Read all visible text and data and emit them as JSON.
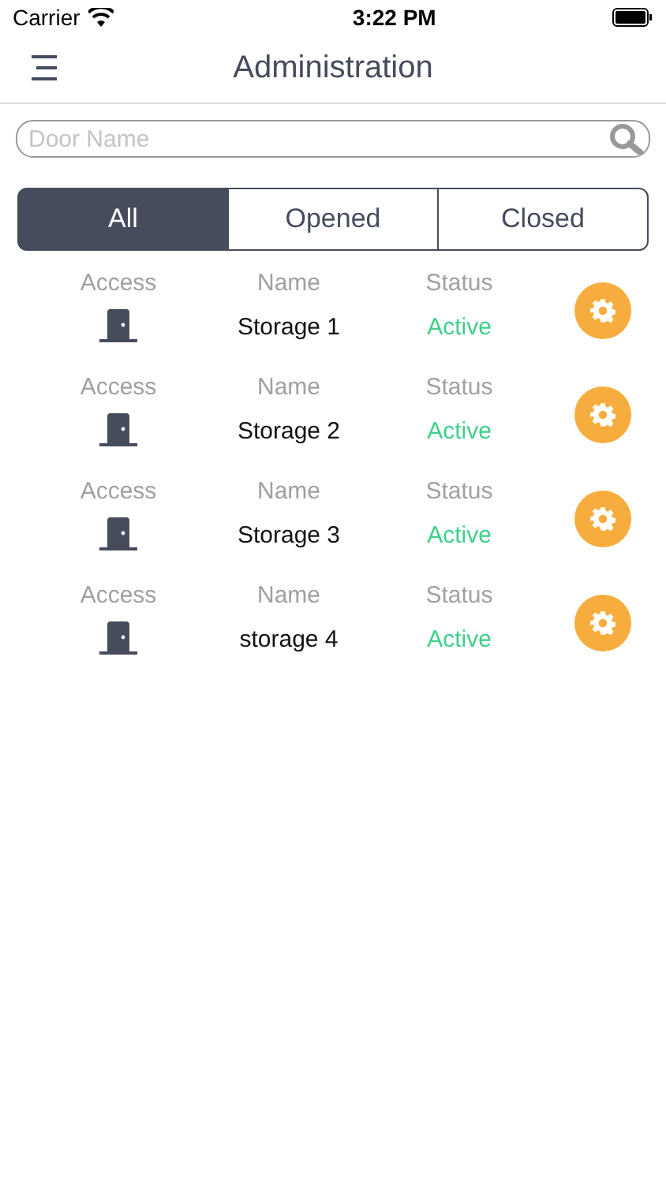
{
  "status_bar": {
    "carrier": "Carrier",
    "time": "3:22 PM"
  },
  "nav": {
    "title": "Administration"
  },
  "search": {
    "placeholder": "Door Name"
  },
  "tabs": [
    {
      "label": "All",
      "selected": true
    },
    {
      "label": "Opened",
      "selected": false
    },
    {
      "label": "Closed",
      "selected": false
    }
  ],
  "doors": [
    {
      "access_label": "Access",
      "name_label": "Name",
      "status_label": "Status",
      "name": "Storage 1",
      "status": "Active"
    },
    {
      "access_label": "Access",
      "name_label": "Name",
      "status_label": "Status",
      "name": "Storage 2",
      "status": "Active"
    },
    {
      "access_label": "Access",
      "name_label": "Name",
      "status_label": "Status",
      "name": "Storage 3",
      "status": "Active"
    },
    {
      "access_label": "Access",
      "name_label": "Name",
      "status_label": "Status",
      "name": "storage 4",
      "status": "Active"
    }
  ]
}
